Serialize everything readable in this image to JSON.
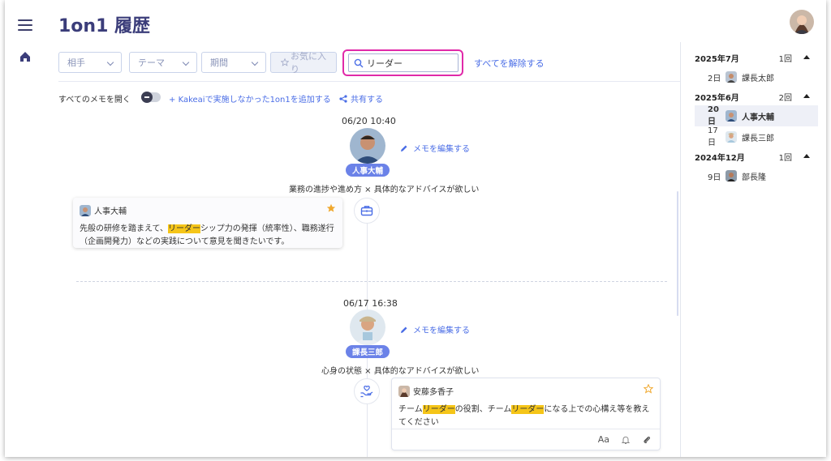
{
  "app": {
    "title": "1on1 履歴"
  },
  "filters": {
    "partner": "相手",
    "theme": "テーマ",
    "period": "期間",
    "favorite": "お気に入り",
    "search_value": "リーダー",
    "clear_all": "すべてを解除する"
  },
  "toolbar": {
    "open_all_memos": "すべてのメモを開く",
    "add_outside": "Kakeaiで実施しなかった1on1を追加する",
    "share": "共有する"
  },
  "entries": [
    {
      "datetime": "06/20 10:40",
      "name": "人事大輔",
      "edit_label": "メモを編集する",
      "theme": "業務の進捗や進め方 × 具体的なアドバイスが欲しい",
      "card_author": "人事大輔",
      "card_text_before": "先般の研修を踏まえて、",
      "card_highlight": "リーダー",
      "card_text_after": "シップ力の発揮（統率性）、職務遂行（企画開発力）などの実践について意見を聞きたいです。",
      "favorite": true
    },
    {
      "datetime": "06/17 16:38",
      "name": "課長三郎",
      "edit_label": "メモを編集する",
      "theme": "心身の状態 × 具体的なアドバイスが欲しい",
      "card_author": "安藤多香子",
      "card_text_1": "チーム",
      "card_highlight_1": "リーダー",
      "card_text_2": "の役割、チーム",
      "card_highlight_2": "リーダー",
      "card_text_3": "になる上での心構え等を教えてください",
      "font_button": "Aa",
      "favorite": false
    }
  ],
  "history": [
    {
      "month": "2025年7月",
      "count": "1回",
      "items": [
        {
          "day": "2日",
          "name": "課長太郎"
        }
      ]
    },
    {
      "month": "2025年6月",
      "count": "2回",
      "items": [
        {
          "day": "20日",
          "name": "人事大輔",
          "active": true
        },
        {
          "day": "17日",
          "name": "課長三郎"
        }
      ]
    },
    {
      "month": "2024年12月",
      "count": "1回",
      "items": [
        {
          "day": "9日",
          "name": "部長隆"
        }
      ]
    }
  ],
  "colors": {
    "accent": "#4a6de6",
    "highlight": "#f5c518",
    "search_outline": "#e02aa9",
    "pill": "#6b82e8"
  }
}
